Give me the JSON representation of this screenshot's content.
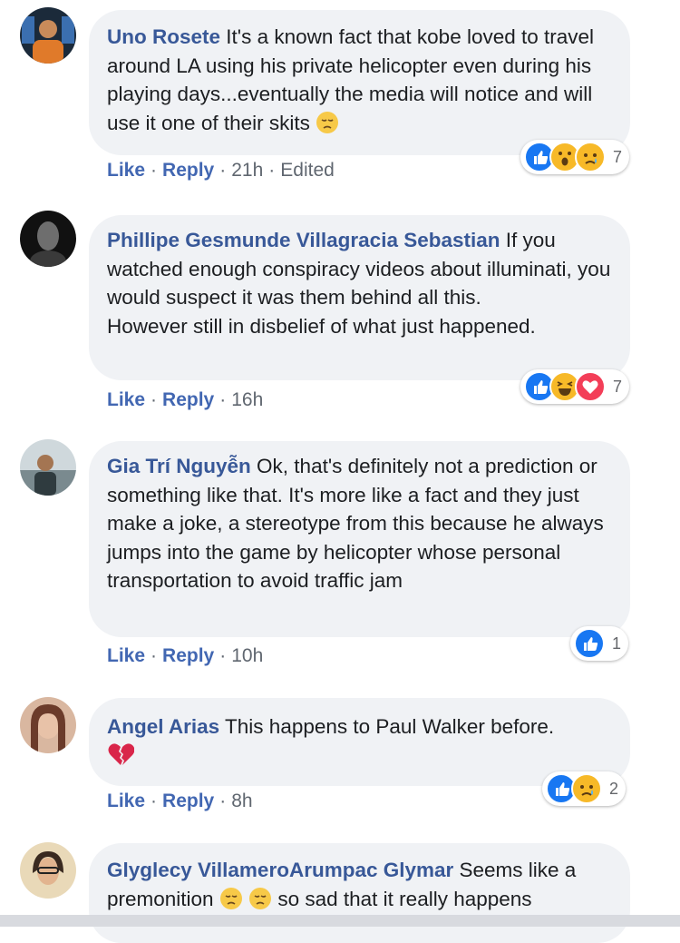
{
  "comments": [
    {
      "author": "Uno Rosete",
      "text": " It's a known fact that kobe loved to travel around LA using his private helicopter even during his playing days...eventually the media will notice and will use it one of their skits",
      "like": "Like",
      "reply": "Reply",
      "time": "21h",
      "edited": "Edited",
      "reaction_count": "7",
      "reactions": [
        "like-icon",
        "wow-icon",
        "sad-icon"
      ]
    },
    {
      "author": "Phillipe Gesmunde Villagracia Sebastian",
      "text": " If you watched enough conspiracy videos about illuminati, you would suspect it was them behind all this.\nHowever still in disbelief of what just happened.",
      "like": "Like",
      "reply": "Reply",
      "time": "16h",
      "reaction_count": "7",
      "reactions": [
        "like-icon",
        "haha-icon",
        "love-icon"
      ]
    },
    {
      "author": "Gia Trí Nguyễn",
      "text": " Ok, that's definitely not a prediction or something like that. It's more like a fact and they just make a joke, a stereotype from this because he always jumps into the game by helicopter whose personal transportation to avoid traffic jam",
      "like": "Like",
      "reply": "Reply",
      "time": "10h",
      "reaction_count": "1",
      "reactions": [
        "like-icon"
      ]
    },
    {
      "author": "Angel Arias",
      "text": " This happens to Paul Walker before.",
      "like": "Like",
      "reply": "Reply",
      "time": "8h",
      "reaction_count": "2",
      "reactions": [
        "like-icon",
        "sad-icon"
      ]
    },
    {
      "author": "Glyglecy VillameroArumpac Glymar",
      "text": " Seems like a premonition",
      "text_tail": " so sad that it really happens"
    }
  ],
  "dot": "·",
  "colors": {
    "author": "#385898",
    "link": "#4267b2",
    "bubble": "#f0f2f5",
    "like_reaction": "#1877f2",
    "emoji_yellow": "#f7b928",
    "love_reaction": "#f33e58"
  }
}
